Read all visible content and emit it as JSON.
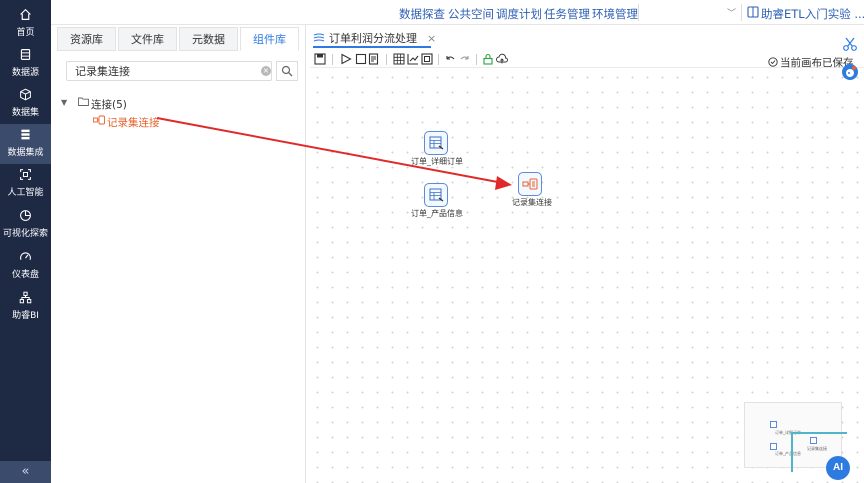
{
  "nav": {
    "items": [
      {
        "label": "首页",
        "icon": "home-icon"
      },
      {
        "label": "数据源",
        "icon": "database-icon"
      },
      {
        "label": "数据集",
        "icon": "cube-icon"
      },
      {
        "label": "数据集成",
        "icon": "layers-icon",
        "active": true
      },
      {
        "label": "人工智能",
        "icon": "ai-scan-icon"
      },
      {
        "label": "可视化探索",
        "icon": "pie-chart-icon"
      },
      {
        "label": "仪表盘",
        "icon": "gauge-icon"
      },
      {
        "label": "助睿BI",
        "icon": "org-tree-icon"
      }
    ],
    "collapse_glyph": "«"
  },
  "topbar": {
    "menus": [
      "数据探查",
      "公共空间",
      "调度计划",
      "任务管理",
      "环境管理"
    ],
    "help_link": "助睿ETL入门实验 ..."
  },
  "leftpanel": {
    "tabs": [
      "资源库",
      "文件库",
      "元数据",
      "组件库"
    ],
    "active_tab": "组件库",
    "search": {
      "value": "记录集连接",
      "placeholder": ""
    },
    "tree": {
      "node": "连接(5)",
      "leaf": "记录集连接"
    }
  },
  "editor": {
    "tab_title": "订单利润分流处理",
    "tab_close": "×",
    "save_status": "当前画布已保存",
    "nodes": [
      {
        "label": "订单_详细订单"
      },
      {
        "label": "订单_产品信息"
      },
      {
        "label": "记录集连接"
      }
    ]
  },
  "floating": {
    "ai_label": "AI"
  },
  "colors": {
    "nav_bg": "#1e2a44",
    "accent": "#2d7be0",
    "drag_arrow": "#e02a2a",
    "leaf_text": "#e8622c"
  }
}
